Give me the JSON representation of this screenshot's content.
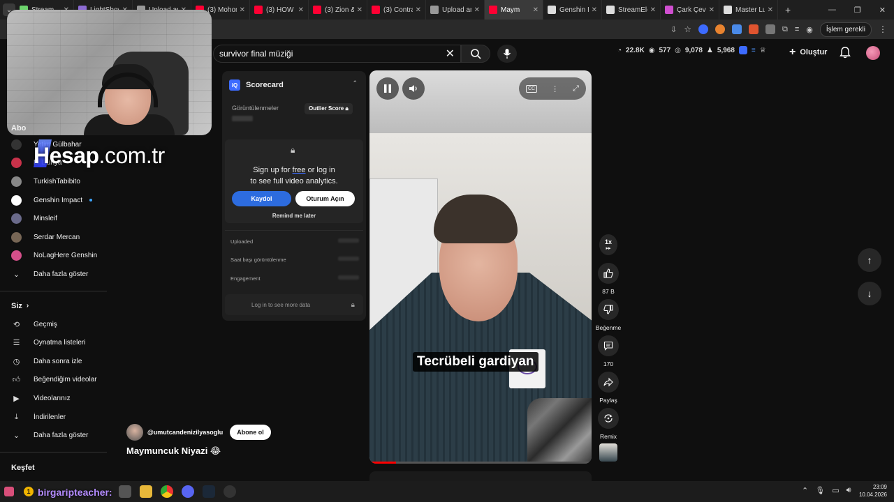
{
  "browser": {
    "tabs": [
      {
        "label": "Stream",
        "color": "#6bd36b"
      },
      {
        "label": "LightShow",
        "color": "#8c6bd3"
      },
      {
        "label": "Upload an",
        "color": "#999999"
      },
      {
        "label": "(3) Mohon",
        "color": "#ff0033"
      },
      {
        "label": "(3) HOW T",
        "color": "#ff0033"
      },
      {
        "label": "(3) Zion &",
        "color": "#ff0033"
      },
      {
        "label": "(3) Contra",
        "color": "#ff0033"
      },
      {
        "label": "Upload an",
        "color": "#999999"
      },
      {
        "label": "Maym",
        "color": "#ff0033",
        "active": true
      },
      {
        "label": "Genshin Im",
        "color": "#dddddd"
      },
      {
        "label": "StreamEle",
        "color": "#dddddd"
      },
      {
        "label": "Çark Çevir",
        "color": "#d04fd0"
      },
      {
        "label": "Master Lu",
        "color": "#dddddd"
      }
    ],
    "islem_label": "İşlem gerekli"
  },
  "search": {
    "query": "survivor final müziği"
  },
  "header_stats": {
    "views_a": "22.8K",
    "views_b": "577",
    "views_c": "9,078",
    "views_d": "5,968"
  },
  "create_label": "Oluştur",
  "overlay": {
    "brand": "Hesap",
    "domain": ".com.tr"
  },
  "sidebar": {
    "subs_heading": "Abo",
    "subscriptions": [
      {
        "label": "Yetim Gülbahar"
      },
      {
        "label": "Bi Dünya"
      },
      {
        "label": "TurkishTabibito"
      },
      {
        "label": "Genshin Impact",
        "dot": true
      },
      {
        "label": "Minsleif"
      },
      {
        "label": "Serdar Mercan"
      },
      {
        "label": "NoLagHere Genshin"
      }
    ],
    "show_more_1": "Daha fazla göster",
    "you_heading": "Siz",
    "you_items": [
      {
        "label": "Geçmiş"
      },
      {
        "label": "Oynatma listeleri"
      },
      {
        "label": "Daha sonra izle"
      },
      {
        "label": "Beğendiğim videolar"
      },
      {
        "label": "Videolarınız"
      },
      {
        "label": "İndirilenler"
      }
    ],
    "show_more_2": "Daha fazla göster",
    "explore_heading": "Keşfet"
  },
  "scorecard": {
    "title": "Scorecard",
    "views_label": "Görüntülenmeler",
    "outlier_label": "Outlier Score",
    "signup_line1_pre": "Sign up for ",
    "signup_free": "free",
    "signup_line1_post": " or log in",
    "signup_line2": "to see full video analytics.",
    "register_btn": "Kaydol",
    "login_btn": "Oturum Açın",
    "remind_label": "Remind me later",
    "rows": [
      "Uploaded",
      "Saat başı görüntülenme",
      "Engagement"
    ],
    "more_data": "Log in to see more data"
  },
  "video": {
    "caption": "Tecrübeli gardiyan",
    "progress": 0.12,
    "speed": "1x",
    "likes": "87 B",
    "dislike_label": "Beğenme",
    "comments": "170",
    "share_label": "Paylaş",
    "remix_label": "Remix"
  },
  "channel": {
    "handle": "@umutcandenizilyasoglu",
    "subscribe": "Abone ol"
  },
  "video_title": "Maymuncuk Niyazi 😂",
  "taskbar": {
    "username": "birgaripteacher:",
    "time": "23:09",
    "date": "10.04.2026"
  }
}
